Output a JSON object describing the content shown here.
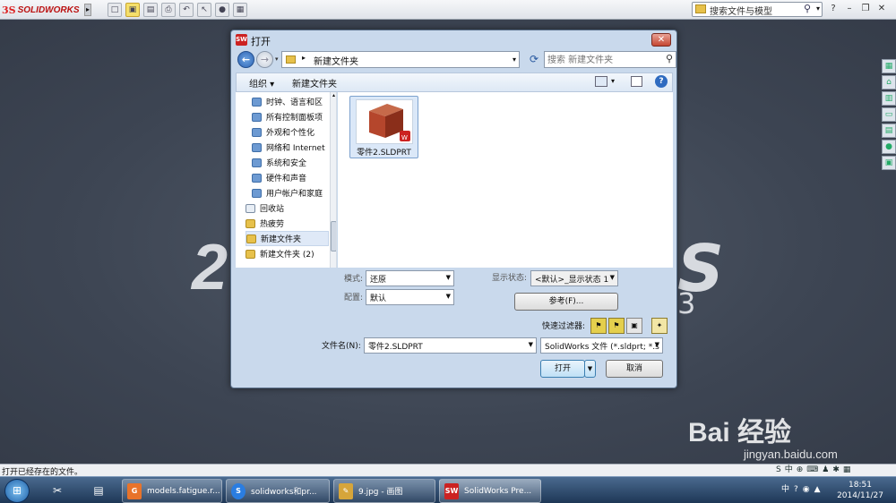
{
  "app": {
    "logo_ds": "3S",
    "logo_text": "SOLIDWORKS",
    "search_placeholder": "搜索文件与模型",
    "status_text": "打开已经存在的文件。",
    "watermark": "Bai 经验",
    "watermark_url": "jingyan.baidu.com"
  },
  "dialog": {
    "title": "打开",
    "address_path": "新建文件夹",
    "search_placeholder": "搜索 新建文件夹",
    "organize_label": "组织 ▾",
    "new_folder_label": "新建文件夹",
    "nav_items": [
      {
        "label": "时钟、语言和区",
        "icon": "clock-region-icon"
      },
      {
        "label": "所有控制面板项",
        "icon": "control-panel-icon"
      },
      {
        "label": "外观和个性化",
        "icon": "appearance-icon"
      },
      {
        "label": "网络和 Internet",
        "icon": "network-icon"
      },
      {
        "label": "系统和安全",
        "icon": "system-security-icon"
      },
      {
        "label": "硬件和声音",
        "icon": "hardware-sound-icon"
      },
      {
        "label": "用户帐户和家庭",
        "icon": "user-accounts-icon"
      },
      {
        "label": "回收站",
        "icon": "recycle-bin-icon"
      },
      {
        "label": "热疲劳",
        "icon": "folder-icon"
      },
      {
        "label": "新建文件夹",
        "icon": "folder-icon",
        "selected": true
      },
      {
        "label": "新建文件夹 (2)",
        "icon": "folder-icon"
      }
    ],
    "files": [
      {
        "name": "零件2.SLDPRT"
      }
    ],
    "mode_label": "模式:",
    "mode_value": "还原",
    "config_label": "配置:",
    "config_value": "默认",
    "display_state_label": "显示状态:",
    "display_state_value": "<默认>_显示状态 1",
    "references_button": "参考(F)...",
    "quick_filter_label": "快速过滤器:",
    "filename_label": "文件名(N):",
    "filename_value": "零件2.SLDPRT",
    "filetype_value": "SolidWorks 文件 (*.sldprt; *.s",
    "open_button": "打开",
    "cancel_button": "取消"
  },
  "taskbar": {
    "tasks": [
      {
        "label": "models.fatigue.r...",
        "color": "#e8732a"
      },
      {
        "label": "solidworks和pr...",
        "color": "#2a7de1"
      },
      {
        "label": "9.jpg - 画图",
        "color": "#d6a53a"
      },
      {
        "label": "SolidWorks Pre...",
        "color": "#c22"
      }
    ],
    "tray_ime": "中",
    "time": "18:51",
    "date": "2014/11/27"
  },
  "colors": {
    "accent": "#2c63b3",
    "brand": "#cc2222",
    "background": "#3c4452"
  }
}
